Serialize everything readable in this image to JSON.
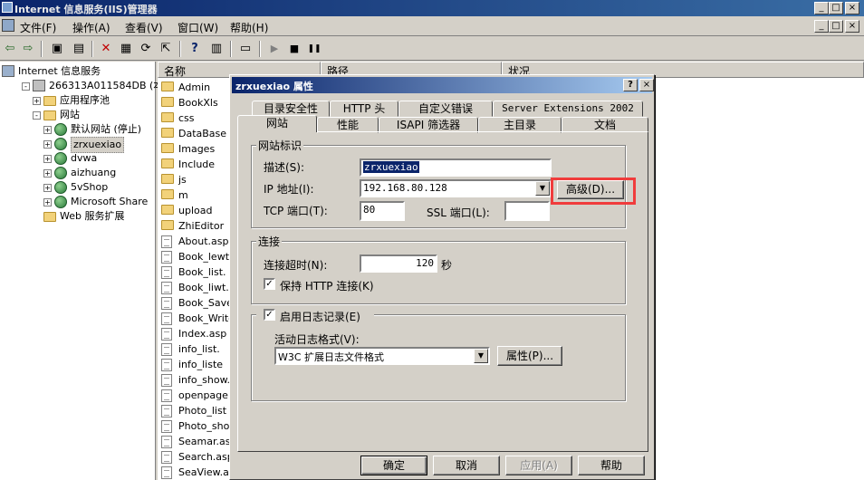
{
  "window": {
    "title": "Internet 信息服务(IIS)管理器",
    "controls_top": [
      "_",
      "□",
      "×"
    ],
    "controls_inner": [
      "_",
      "□",
      "×"
    ]
  },
  "menu": [
    "文件(F)",
    "操作(A)",
    "查看(V)",
    "窗口(W)",
    "帮助(H)"
  ],
  "toolbar": {
    "icons": [
      "back-icon",
      "forward-icon",
      "up-folder-icon",
      "show-tree-icon",
      "delete-icon",
      "properties-icon",
      "refresh-icon",
      "export-icon",
      "help-icon",
      "console-icon",
      "computer-icon",
      "play-icon",
      "stop-icon",
      "pause-icon"
    ],
    "glyphs": [
      "⇦",
      "⇨",
      "▣",
      "▤",
      "✕",
      "▦",
      "⟳",
      "⇱",
      "?",
      "▥",
      "▭",
      "▶",
      "■",
      "❚❚"
    ]
  },
  "tree": [
    {
      "label": "Internet 信息服务",
      "icon": "iis-icon",
      "level": 0,
      "exp": ""
    },
    {
      "label": "266313A011584DB (本地计",
      "icon": "server-icon",
      "level": 1,
      "exp": "-"
    },
    {
      "label": "应用程序池",
      "icon": "folder-icon",
      "level": 2,
      "exp": "+"
    },
    {
      "label": "网站",
      "icon": "folder-icon",
      "level": 2,
      "exp": "-"
    },
    {
      "label": "默认网站 (停止)",
      "icon": "globe-icon",
      "level": 3,
      "exp": "+"
    },
    {
      "label": "zrxuexiao",
      "icon": "globe-icon",
      "level": 3,
      "exp": "+",
      "selected": true
    },
    {
      "label": "dvwa",
      "icon": "globe-icon",
      "level": 3,
      "exp": "+"
    },
    {
      "label": "aizhuang",
      "icon": "globe-icon",
      "level": 3,
      "exp": "+"
    },
    {
      "label": "5vShop",
      "icon": "globe-icon",
      "level": 3,
      "exp": "+"
    },
    {
      "label": "Microsoft Share",
      "icon": "globe-icon",
      "level": 3,
      "exp": "+"
    },
    {
      "label": "Web 服务扩展",
      "icon": "folder-icon",
      "level": 2,
      "exp": ""
    }
  ],
  "list": {
    "headers": [
      "名称",
      "路径",
      "状况"
    ],
    "items": [
      {
        "name": "Admin",
        "type": "folder"
      },
      {
        "name": "BookXls",
        "type": "folder"
      },
      {
        "name": "css",
        "type": "folder"
      },
      {
        "name": "DataBase",
        "type": "folder"
      },
      {
        "name": "Images",
        "type": "folder"
      },
      {
        "name": "Include",
        "type": "folder"
      },
      {
        "name": "js",
        "type": "folder"
      },
      {
        "name": "m",
        "type": "folder"
      },
      {
        "name": "upload",
        "type": "folder"
      },
      {
        "name": "ZhiEditor",
        "type": "folder"
      },
      {
        "name": "About.asp",
        "type": "file"
      },
      {
        "name": "Book_lewt.",
        "type": "file"
      },
      {
        "name": "Book_list.",
        "type": "file"
      },
      {
        "name": "Book_liwt.",
        "type": "file"
      },
      {
        "name": "Book_Save.",
        "type": "file"
      },
      {
        "name": "Book_Write",
        "type": "file"
      },
      {
        "name": "Index.asp",
        "type": "file"
      },
      {
        "name": "info_list.",
        "type": "file"
      },
      {
        "name": "info_liste",
        "type": "file"
      },
      {
        "name": "info_show.",
        "type": "file"
      },
      {
        "name": "openpage.a",
        "type": "file"
      },
      {
        "name": "Photo_list",
        "type": "file"
      },
      {
        "name": "Photo_show",
        "type": "file"
      },
      {
        "name": "Seamar.asp",
        "type": "file"
      },
      {
        "name": "Search.asp",
        "type": "file"
      },
      {
        "name": "SeaView.as",
        "type": "file"
      }
    ]
  },
  "dialog": {
    "title": "zrxuexiao 属性",
    "title_buttons": [
      "?",
      "×"
    ],
    "tabs_back": [
      "目录安全性",
      "HTTP 头",
      "自定义错误",
      "Server Extensions 2002"
    ],
    "tabs_front": [
      "网站",
      "性能",
      "ISAPI 筛选器",
      "主目录",
      "文档"
    ],
    "site_id": {
      "group": "网站标识",
      "desc_label": "描述(S):",
      "desc_value": "zrxuexiao",
      "ip_label": "IP 地址(I):",
      "ip_value": "192.168.80.128",
      "advanced_button": "高级(D)...",
      "tcp_label": "TCP 端口(T):",
      "tcp_value": "80",
      "ssl_label": "SSL 端口(L):",
      "ssl_value": ""
    },
    "connection": {
      "group": "连接",
      "timeout_label": "连接超时(N):",
      "timeout_value": "120",
      "timeout_unit": "秒",
      "keepalive_label": "保持 HTTP 连接(K)",
      "keepalive_checked": "✓"
    },
    "logging": {
      "enable_label": "启用日志记录(E)",
      "enable_checked": "✓",
      "format_label": "活动日志格式(V):",
      "format_value": "W3C 扩展日志文件格式",
      "props_button": "属性(P)..."
    },
    "buttons": [
      "确定",
      "取消",
      "应用(A)",
      "帮助"
    ],
    "highlight_color": "#f03c3c"
  }
}
